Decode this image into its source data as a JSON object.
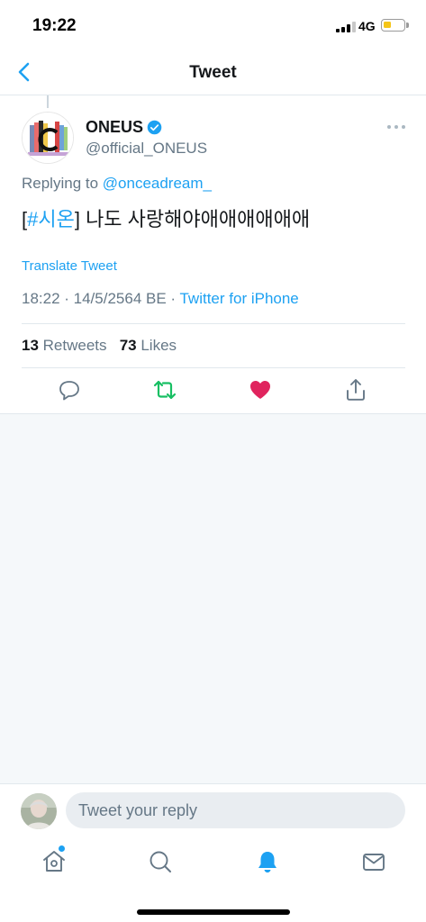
{
  "status_bar": {
    "time": "19:22",
    "network": "4G",
    "battery_level": 0.4,
    "signal_bars": 3
  },
  "header": {
    "title": "Tweet",
    "back_icon": "chevron-left-icon"
  },
  "tweet": {
    "author_name": "ONEUS",
    "verified": true,
    "handle": "@official_ONEUS",
    "reply_prefix": "Replying to ",
    "reply_mention": "@onceadream_",
    "text_open_bracket": "[",
    "hashtag": "#시온",
    "text_rest": "] 나도 사랑해야애애애애애애",
    "translate_label": "Translate Tweet",
    "timestamp": "18:22 · 14/5/2564 BE · ",
    "source": "Twitter for iPhone",
    "retweets_count": "13",
    "retweets_label": " Retweets",
    "likes_count": "73",
    "likes_label": " Likes",
    "liked": true
  },
  "actions": [
    "reply-icon",
    "retweet-icon",
    "like-icon",
    "share-icon"
  ],
  "composer": {
    "placeholder": "Tweet your reply"
  },
  "tabbar": [
    "home-icon",
    "search-icon",
    "notifications-icon",
    "messages-icon"
  ],
  "colors": {
    "accent": "#1da1f2",
    "retweet": "#17bf63",
    "like": "#e0245e",
    "secondary_text": "#657786"
  }
}
